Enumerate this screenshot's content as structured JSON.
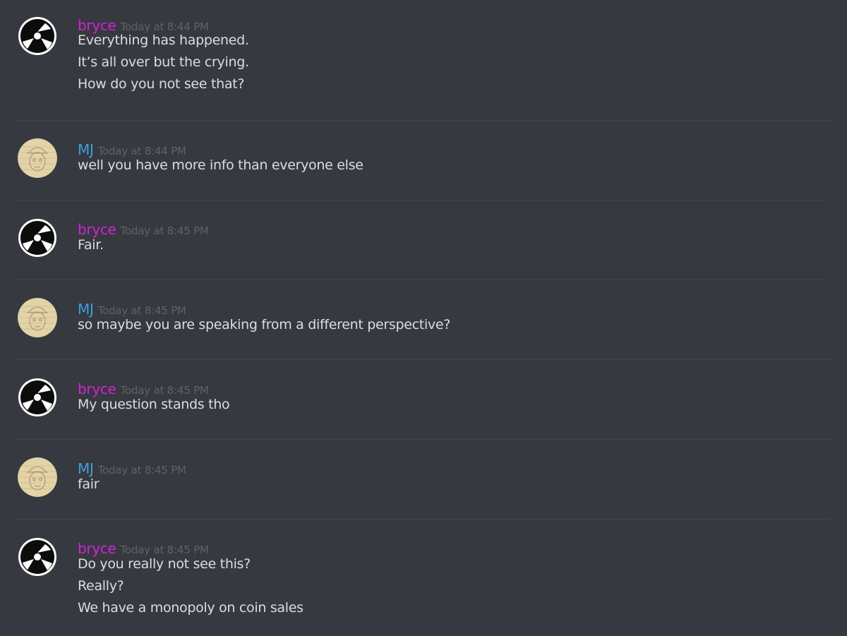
{
  "messages": [
    {
      "author": "bryce",
      "timestamp": "Today at 8:44 PM",
      "avatar_icon": "record-45-adapter-icon",
      "lines": [
        "Everything has happened.",
        "It’s all over but the crying.",
        "How do you not see that?"
      ]
    },
    {
      "author": "MJ",
      "timestamp": "Today at 8:44 PM",
      "avatar_icon": "sketched-face-icon",
      "lines": [
        "well you have more info than everyone else"
      ]
    },
    {
      "author": "bryce",
      "timestamp": "Today at 8:45 PM",
      "avatar_icon": "record-45-adapter-icon",
      "lines": [
        "Fair."
      ]
    },
    {
      "author": "MJ",
      "timestamp": "Today at 8:45 PM",
      "avatar_icon": "sketched-face-icon",
      "lines": [
        "so maybe you are speaking from a different perspective?"
      ]
    },
    {
      "author": "bryce",
      "timestamp": "Today at 8:45 PM",
      "avatar_icon": "record-45-adapter-icon",
      "lines": [
        "My question stands tho"
      ]
    },
    {
      "author": "MJ",
      "timestamp": "Today at 8:45 PM",
      "avatar_icon": "sketched-face-icon",
      "lines": [
        "fair"
      ]
    },
    {
      "author": "bryce",
      "timestamp": "Today at 8:45 PM",
      "avatar_icon": "record-45-adapter-icon",
      "lines": [
        "Do you really not see this?",
        "Really?",
        "We have a monopoly on coin sales"
      ]
    }
  ],
  "colors": {
    "background": "#36393f",
    "bryce_name": "#d222d8",
    "mj_name": "#3f9fdc",
    "timestamp": "#5f6269",
    "message_text": "#dcddde",
    "divider": "#42454b"
  }
}
